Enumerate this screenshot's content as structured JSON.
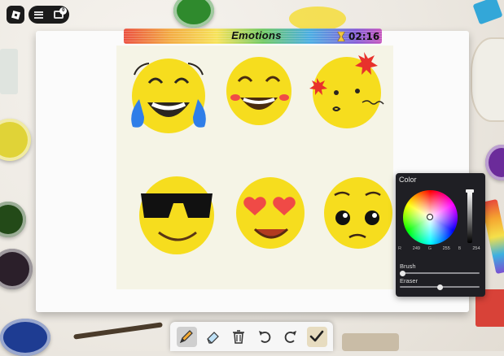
{
  "header": {
    "title": "Emotions",
    "timer": "02:16",
    "chat_badge_count": "0"
  },
  "color_panel": {
    "title": "Color",
    "rgb": [
      {
        "label": "R",
        "value": "249"
      },
      {
        "label": "G",
        "value": "255"
      },
      {
        "label": "B",
        "value": "254"
      }
    ],
    "brush_label": "Brush",
    "eraser_label": "Eraser",
    "brush_size_fraction": 0.0,
    "eraser_size_fraction": 0.5
  },
  "toolbar": {
    "tools": [
      "pencil-icon",
      "eraser-icon",
      "trash-icon",
      "undo-icon",
      "redo-icon",
      "checkmark-icon"
    ],
    "active_tool": "pencil"
  },
  "drawing": {
    "emoji_faces": [
      "laughing-tears",
      "grinning",
      "angry-symbols",
      "sunglasses",
      "heart-eyes",
      "pleading"
    ],
    "face_color": "#f6dd1e",
    "blush_color": "#f04a46",
    "tear_color": "#2f7ee8"
  }
}
